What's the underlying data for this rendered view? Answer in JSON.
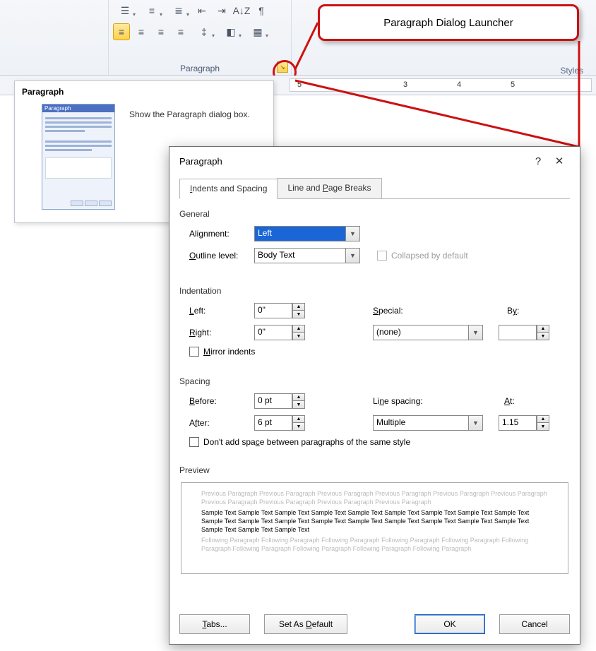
{
  "callout": {
    "label": "Paragraph Dialog Launcher"
  },
  "ribbon": {
    "group_label": "Paragraph",
    "styles_label": "Styles"
  },
  "tooltip": {
    "title": "Paragraph",
    "description": "Show the Paragraph dialog box."
  },
  "dialog": {
    "title": "Paragraph",
    "help_symbol": "?",
    "close_symbol": "✕",
    "tabs": {
      "indents_spacing": "Indents and Spacing",
      "line_page_breaks": "Line and Page Breaks"
    },
    "general": {
      "section": "General",
      "alignment_label": "Alignment:",
      "alignment_value": "Left",
      "outline_label": "Outline level:",
      "outline_value": "Body Text",
      "collapsed_label": "Collapsed by default"
    },
    "indent": {
      "section": "Indentation",
      "left_label": "Left:",
      "left_value": "0\"",
      "right_label": "Right:",
      "right_value": "0\"",
      "special_label": "Special:",
      "special_value": "(none)",
      "by_label": "By:",
      "by_value": "",
      "mirror_label": "Mirror indents"
    },
    "spacing": {
      "section": "Spacing",
      "before_label": "Before:",
      "before_value": "0 pt",
      "after_label": "After:",
      "after_value": "6 pt",
      "line_spacing_label": "Line spacing:",
      "line_spacing_value": "Multiple",
      "at_label": "At:",
      "at_value": "1.15",
      "no_space_label": "Don't add space between paragraphs of the same style"
    },
    "preview": {
      "section": "Preview",
      "prev_para": "Previous Paragraph Previous Paragraph Previous Paragraph Previous Paragraph Previous Paragraph Previous Paragraph Previous Paragraph Previous Paragraph Previous Paragraph Previous Paragraph",
      "sample": "Sample Text Sample Text Sample Text Sample Text Sample Text Sample Text Sample Text Sample Text Sample Text Sample Text Sample Text Sample Text Sample Text Sample Text Sample Text Sample Text Sample Text Sample Text Sample Text Sample Text Sample Text",
      "follow_para": "Following Paragraph Following Paragraph Following Paragraph Following Paragraph Following Paragraph Following Paragraph Following Paragraph Following Paragraph Following Paragraph Following Paragraph"
    },
    "buttons": {
      "tabs": "Tabs...",
      "set_default": "Set As Default",
      "ok": "OK",
      "cancel": "Cancel"
    }
  },
  "ruler": {
    "marks": [
      5,
      3,
      4,
      5
    ]
  }
}
